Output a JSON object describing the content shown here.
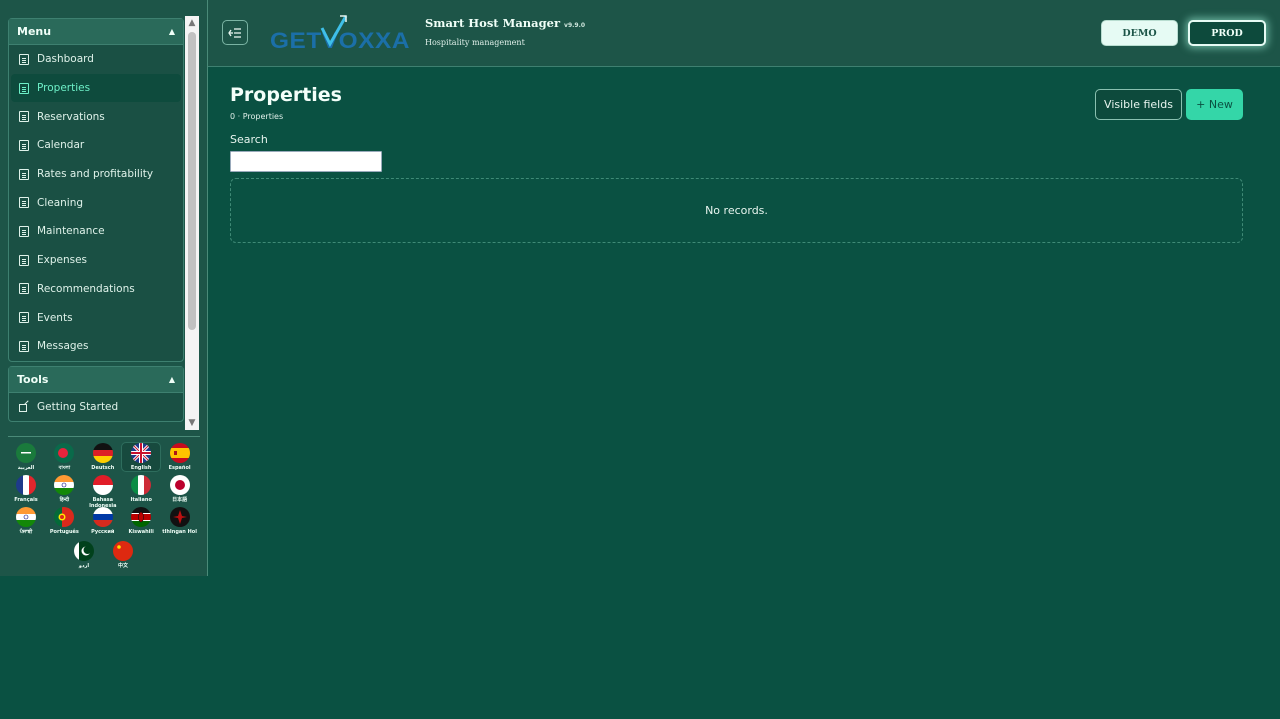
{
  "sidebar": {
    "menu": {
      "title": "Menu",
      "items": [
        {
          "label": "Dashboard",
          "active": false
        },
        {
          "label": "Properties",
          "active": true
        },
        {
          "label": "Reservations",
          "active": false
        },
        {
          "label": "Calendar",
          "active": false
        },
        {
          "label": "Rates and profitability",
          "active": false
        },
        {
          "label": "Cleaning",
          "active": false
        },
        {
          "label": "Maintenance",
          "active": false
        },
        {
          "label": "Expenses",
          "active": false
        },
        {
          "label": "Recommendations",
          "active": false
        },
        {
          "label": "Events",
          "active": false
        },
        {
          "label": "Messages",
          "active": false
        }
      ]
    },
    "tools": {
      "title": "Tools",
      "items": [
        {
          "label": "Getting Started"
        }
      ]
    },
    "languages": [
      {
        "label": "العربية",
        "flag": "sa"
      },
      {
        "label": "বাংলা",
        "flag": "bd"
      },
      {
        "label": "Deutsch",
        "flag": "de"
      },
      {
        "label": "English",
        "flag": "gb",
        "selected": true
      },
      {
        "label": "Español",
        "flag": "es"
      },
      {
        "label": "Français",
        "flag": "fr"
      },
      {
        "label": "हिन्दी",
        "flag": "in"
      },
      {
        "label": "Bahasa Indonesia",
        "flag": "id"
      },
      {
        "label": "Italiano",
        "flag": "it"
      },
      {
        "label": "日本語",
        "flag": "jp"
      },
      {
        "label": "ਪੰਜਾਬੀ",
        "flag": "in-pa"
      },
      {
        "label": "Português",
        "flag": "pt"
      },
      {
        "label": "Русский",
        "flag": "ru"
      },
      {
        "label": "Kiswahili",
        "flag": "ke"
      },
      {
        "label": "tlhIngan Hol",
        "flag": "klingon"
      },
      {
        "label": "اردو",
        "flag": "pk"
      },
      {
        "label": "中文",
        "flag": "cn"
      }
    ]
  },
  "header": {
    "logo_text": "GETVOXXA",
    "app_title": "Smart Host Manager",
    "version": "v9.9.0",
    "subtitle": "Hospitality management",
    "demo_label": "DEMO",
    "prod_label": "PROD"
  },
  "main": {
    "title": "Properties",
    "count_text": "0 · Properties",
    "search_label": "Search",
    "search_value": "",
    "visible_fields_label": "Visible fields",
    "new_label": "+ New",
    "empty_text": "No records."
  },
  "colors": {
    "background": "#0a5142",
    "sidebar": "#1d5548",
    "accent": "#34d6a8",
    "active_text": "#6ef0c8"
  }
}
